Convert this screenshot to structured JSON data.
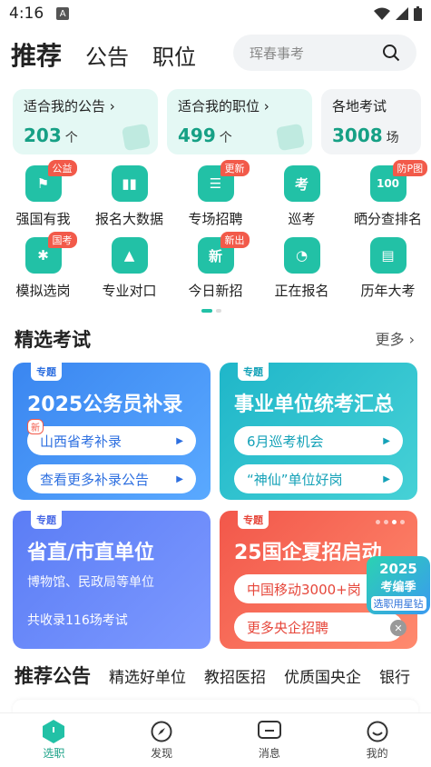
{
  "status": {
    "time": "4:16",
    "a_badge": "A"
  },
  "header": {
    "tabs": [
      {
        "label": "推荐",
        "active": true
      },
      {
        "label": "公告"
      },
      {
        "label": "职位"
      }
    ],
    "search_placeholder": "珲春事考"
  },
  "cards": [
    {
      "title": "适合我的公告",
      "value": "203",
      "unit": "个"
    },
    {
      "title": "适合我的职位",
      "value": "499",
      "unit": "个"
    },
    {
      "title": "各地考试",
      "value": "3008",
      "unit": "场"
    }
  ],
  "grid": [
    {
      "label": "强国有我",
      "icon": "shield-icon",
      "badge": "公益",
      "glyph": "⚑"
    },
    {
      "label": "报名大数据",
      "icon": "chart-icon",
      "badge": "",
      "glyph": "▮▮"
    },
    {
      "label": "专场招聘",
      "icon": "briefcase-icon",
      "badge": "更新",
      "glyph": "☰"
    },
    {
      "label": "巡考",
      "icon": "exam-doc-icon",
      "badge": "",
      "glyph": "考"
    },
    {
      "label": "晒分查排名",
      "icon": "score-icon",
      "badge": "防P图",
      "glyph": "100"
    },
    {
      "label": "模拟选岗",
      "icon": "fan-icon",
      "badge": "国考",
      "glyph": "✱"
    },
    {
      "label": "专业对口",
      "icon": "graduation-cap-icon",
      "badge": "",
      "glyph": "▲"
    },
    {
      "label": "今日新招",
      "icon": "new-calendar-icon",
      "badge": "新出",
      "glyph": "新"
    },
    {
      "label": "正在报名",
      "icon": "clock-icon",
      "badge": "",
      "glyph": "◔"
    },
    {
      "label": "历年大考",
      "icon": "history-doc-icon",
      "badge": "",
      "glyph": "▤"
    }
  ],
  "featured": {
    "title": "精选考试",
    "more": "更多 ›"
  },
  "exams": [
    {
      "tag": "专题",
      "title": "2025公务员补录",
      "pills": [
        "山西省考补录",
        "查看更多补录公告"
      ],
      "new_badge": "新"
    },
    {
      "tag": "专题",
      "title": "事业单位统考汇总",
      "pills": [
        "6月巡考机会",
        "“神仙”单位好岗"
      ]
    },
    {
      "tag": "专题",
      "title": "省直/市直单位",
      "sub": "博物馆、民政局等单位",
      "foot": "共收录116场考试"
    },
    {
      "tag": "专题",
      "title": "25国企夏招启动",
      "pills": [
        "中国移动3000+岗",
        "更多央企招聘"
      ]
    }
  ],
  "float_ad": {
    "year": "2025",
    "name": "考编季",
    "sub": "选职用星钻"
  },
  "recommend": {
    "main": "推荐公告",
    "others": [
      "精选好单位",
      "教招医招",
      "优质国央企",
      "银行"
    ]
  },
  "bottom_nav": [
    {
      "label": "选职",
      "icon": "home-icon",
      "active": true
    },
    {
      "label": "发现",
      "icon": "compass-icon"
    },
    {
      "label": "消息",
      "icon": "message-icon"
    },
    {
      "label": "我的",
      "icon": "profile-icon"
    }
  ],
  "colors": {
    "accent": "#16a085",
    "teal": "#22c1a6",
    "badge": "#f25a4a"
  }
}
